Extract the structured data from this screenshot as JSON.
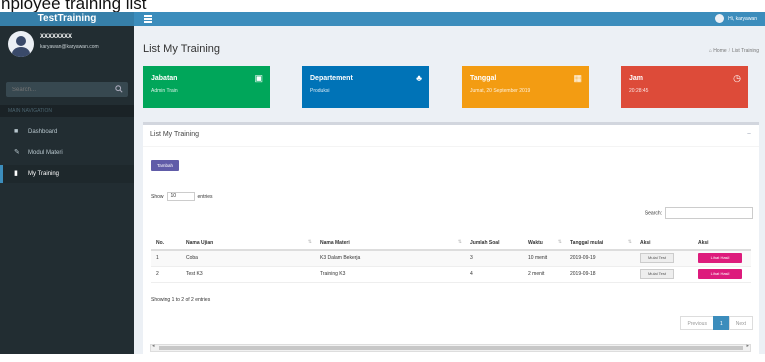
{
  "caption": "nployee training list",
  "brand": "TestTraining",
  "sidebar": {
    "user_name": "XXXXXXXX",
    "user_email": "karyawan@karyawan.com",
    "search_placeholder": "Search...",
    "nav_header": "MAIN NAVIGATION",
    "items": [
      {
        "label": "Dashboard",
        "icon": "dashboard-icon"
      },
      {
        "label": "Modul Materi",
        "icon": "pen-icon"
      },
      {
        "label": "My Training",
        "icon": "book-icon"
      }
    ]
  },
  "topbar": {
    "user": "Hi, karyawan"
  },
  "page": {
    "title": "List My Training",
    "crumb_home": "Home",
    "crumb_current": "List Training"
  },
  "cards": [
    {
      "label": "Jabatan",
      "value": "Admin Train",
      "color": "#00a65a",
      "icon": "id-card-icon"
    },
    {
      "label": "Departement",
      "value": "Produksi",
      "color": "#0073b7",
      "icon": "sitemap-icon"
    },
    {
      "label": "Tanggal",
      "value": "Jumat, 20 September 2019",
      "color": "#f39c12",
      "icon": "calendar-icon"
    },
    {
      "label": "Jam",
      "value": "20:28:45",
      "color": "#dd4b39",
      "icon": "clock-icon"
    }
  ],
  "box": {
    "title": "List My Training",
    "add_button": "Tambah",
    "show_prefix": "Show",
    "show_value": "10",
    "show_suffix": "entries",
    "search_label": "Search:",
    "columns": [
      "No.",
      "Nama Ujian",
      "Nama Materi",
      "Jumlah Soal",
      "Waktu",
      "Tanggal mulai",
      "Aksi",
      "Aksi"
    ],
    "rows": [
      {
        "no": "1",
        "ujian": "Coba",
        "materi": "K3 Dalam Bekerja",
        "soal": "3",
        "waktu": "10 menit",
        "tanggal": "2019-09-19",
        "btn1": "Mulai Test",
        "btn2": "Lihat Hasil"
      },
      {
        "no": "2",
        "ujian": "Test K3",
        "materi": "Training K3",
        "soal": "4",
        "waktu": "2 menit",
        "tanggal": "2019-09-18",
        "btn1": "Mulai Test",
        "btn2": "Lihat Hasil"
      }
    ],
    "showing": "Showing 1 to 2 of 2 entries",
    "pager": {
      "prev": "Previous",
      "page": "1",
      "next": "Next"
    }
  }
}
